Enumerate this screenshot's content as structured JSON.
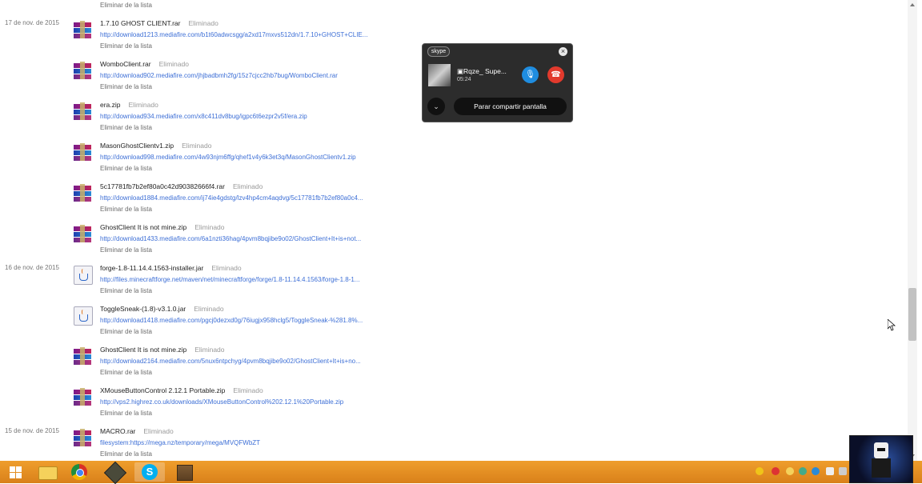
{
  "top_remove": "Eliminar de la lista",
  "remove_label": "Eliminar de la lista",
  "dates": [
    "17 de nov. de 2015",
    "16 de nov. de 2015",
    "15 de nov. de 2015"
  ],
  "downloads": [
    {
      "name": "1.7.10 GHOST CLIENT.rar",
      "status": "Eliminado",
      "url": "http://download1213.mediafire.com/b1t60adwcsgg/a2xd17mxvs512dn/1.7.10+GHOST+CLIE...",
      "icon": "rar-archive-icon"
    },
    {
      "name": "WomboClient.rar",
      "status": "Eliminado",
      "url": "http://download902.mediafire.com/jhjbadbmh2fg/15z7cjcc2hb7bug/WomboClient.rar",
      "icon": "rar-archive-icon"
    },
    {
      "name": "era.zip",
      "status": "Eliminado",
      "url": "http://download934.mediafire.com/x8c411dv8bug/igpc6t6ezpr2v5f/era.zip",
      "icon": "rar-archive-icon"
    },
    {
      "name": "MasonGhostClientv1.zip",
      "status": "Eliminado",
      "url": "http://download998.mediafire.com/4w93njm6ffg/qhef1v4y6k3et3q/MasonGhostClientv1.zip",
      "icon": "rar-archive-icon"
    },
    {
      "name": "5c17781fb7b2ef80a0c42d90382666f4.rar",
      "status": "Eliminado",
      "url": "http://download1884.mediafire.com/ij74ie4gdstg/lzv4hp4cm4aqdvg/5c17781fb7b2ef80a0c4...",
      "icon": "rar-archive-icon"
    },
    {
      "name": "GhostClient It is not mine.zip",
      "status": "Eliminado",
      "url": "http://download1433.mediafire.com/6a1nzti36hag/4pvm8bqjibe9o02/GhostClient+It+is+not...",
      "icon": "rar-archive-icon"
    },
    {
      "name": "forge-1.8-11.14.4.1563-installer.jar",
      "status": "Eliminado",
      "url": "http://files.minecraftforge.net/maven/net/minecraftforge/forge/1.8-11.14.4.1563/forge-1.8-1...",
      "icon": "java-jar-icon"
    },
    {
      "name": "ToggleSneak-(1.8)-v3.1.0.jar",
      "status": "Eliminado",
      "url": "http://download1418.mediafire.com/pgcj0dezxd0g/76iugjx958hclg5/ToggleSneak-%281.8%...",
      "icon": "java-jar-icon"
    },
    {
      "name": "GhostClient It is not mine.zip",
      "status": "Eliminado",
      "url": "http://download2164.mediafire.com/5nux6ntpchyg/4pvm8bqjibe9o02/GhostClient+It+is+no...",
      "icon": "rar-archive-icon"
    },
    {
      "name": "XMouseButtonControl 2.12.1 Portable.zip",
      "status": "Eliminado",
      "url": "http://vps2.highrez.co.uk/downloads/XMouseButtonControl%202.12.1%20Portable.zip",
      "icon": "rar-archive-icon"
    },
    {
      "name": "MACRO.rar",
      "status": "Eliminado",
      "url": "filesystem:https://mega.nz/temporary/mega/MVQFWbZT",
      "icon": "rar-archive-icon"
    }
  ],
  "skype": {
    "logo": "skype",
    "close": "×",
    "contact_name": "▣Rqze_ Supe...",
    "call_time": "05:24",
    "mic_icon": "🎙",
    "hangup_icon": "☎",
    "more_icon": "⌄",
    "share_label": "Parar compartir pantalla"
  },
  "taskbar": {
    "apps": [
      "windows-start-icon",
      "file-explorer-icon",
      "chrome-icon",
      "steam-icon",
      "skype-icon",
      "minecraft-icon"
    ]
  }
}
